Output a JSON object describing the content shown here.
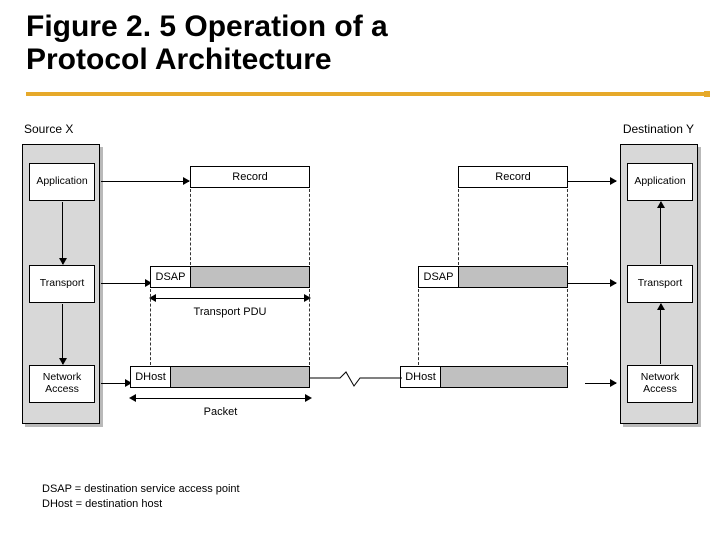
{
  "title_line1": "Figure 2. 5 Operation of a",
  "title_line2": "Protocol Architecture",
  "source_label": "Source X",
  "dest_label": "Destination Y",
  "layers": {
    "application": "Application",
    "transport": "Transport",
    "network_access": "Network\nAccess"
  },
  "pdu": {
    "record": "Record",
    "dsap": "DSAP",
    "transport_pdu": "Transport PDU",
    "dhost": "DHost",
    "packet": "Packet"
  },
  "legend": {
    "dsap": "DSAP = destination service access point",
    "dhost": "DHost = destination host"
  },
  "colors": {
    "accent_rule": "#e6a92a",
    "host_fill": "#d8d8d8",
    "shaded": "#c0c0c0"
  }
}
